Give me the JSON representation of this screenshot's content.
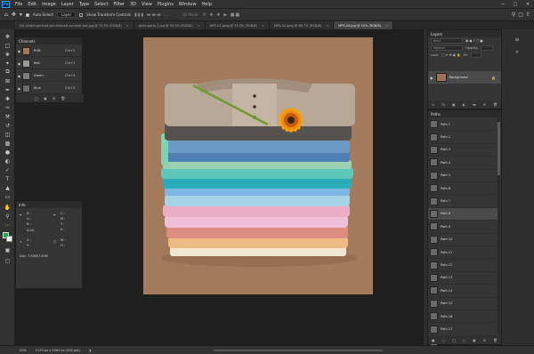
{
  "menubar": {
    "logo": "Ps",
    "items": [
      "File",
      "Edit",
      "Image",
      "Layer",
      "Type",
      "Select",
      "Filter",
      "3D",
      "View",
      "Plugins",
      "Window",
      "Help"
    ]
  },
  "options": {
    "auto_select": "Auto-Select",
    "layer_select": "Layer",
    "show_transform": "Show Transform Controls",
    "mode3d": "3D Mode:"
  },
  "tabs": [
    {
      "label": "full-length-portrait-girl-dressed-summer-hat.jpg @ 13.5% (RGB/8)",
      "active": false
    },
    {
      "label": "glass-parts-1.jpg @ 33.3% (RGB/8)",
      "active": false
    },
    {
      "label": "MPS-01.jpeg @ 33.3% (RGB/8)",
      "active": false
    },
    {
      "label": "MPS-02.jpeg @ 66.7% (RGB/8)",
      "active": false
    },
    {
      "label": "MPS-04.jpg @ 50% (RGB/8)",
      "active": true
    }
  ],
  "channels": {
    "title": "Channels",
    "rows": [
      {
        "name": "RGB",
        "shortcut": "Ctrl+2"
      },
      {
        "name": "Red",
        "shortcut": "Ctrl+3"
      },
      {
        "name": "Green",
        "shortcut": "Ctrl+4"
      },
      {
        "name": "Blue",
        "shortcut": "Ctrl+5"
      }
    ]
  },
  "info": {
    "title": "Info",
    "r": "R :",
    "g": "G :",
    "b": "B :",
    "bit": "8-bit",
    "c": "C :",
    "m": "M :",
    "y": "Y :",
    "k": "K :",
    "x": "X :",
    "y2": "Y :",
    "w": "W :",
    "h": "H :",
    "doc": "Doc: 7.63M/7.63M"
  },
  "layers": {
    "title": "Layers",
    "kind": "Kind",
    "normal": "Normal",
    "opacity": "Opacity:",
    "lock": "Lock:",
    "fill": "Fill:",
    "layer_name": "Background"
  },
  "paths": {
    "title": "Paths",
    "items": [
      "Path 1",
      "Path 2",
      "Path 3",
      "Path 4",
      "Path 5",
      "Path 6",
      "Path 7",
      "Path 8",
      "Path 9",
      "Path 10",
      "Path 11",
      "Path 12",
      "Path 13",
      "Path 14",
      "Path 15",
      "Path 16",
      "Path 17",
      "Path 18"
    ],
    "selected_index": 7
  },
  "status": {
    "zoom": "50%",
    "dims": "1233 px x 2000 px (300 ppi)"
  },
  "colors": {
    "foreground": "#1ea54a",
    "background": "#ffffff",
    "canvas_bg": "#a47a5c"
  }
}
